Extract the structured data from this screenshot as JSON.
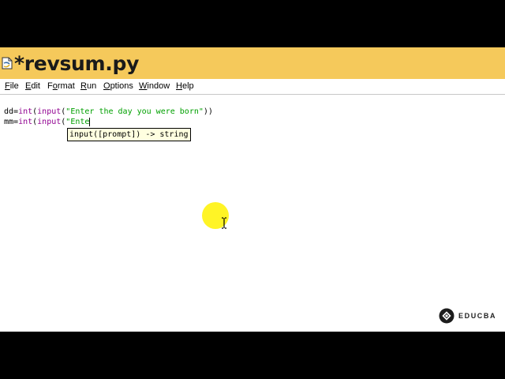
{
  "window": {
    "title": "*revsum.py",
    "title_bar_color": "#f5c95b"
  },
  "menu": {
    "items": [
      {
        "label": "File",
        "underline": "F",
        "rest": "ile"
      },
      {
        "label": "Edit",
        "underline": "E",
        "rest": "dit"
      },
      {
        "label": "Format",
        "prefix": "F",
        "underline": "o",
        "rest": "rmat"
      },
      {
        "label": "Run",
        "underline": "R",
        "rest": "un"
      },
      {
        "label": "Options",
        "underline": "O",
        "rest": "ptions"
      },
      {
        "label": "Window",
        "underline": "W",
        "rest": "indow"
      },
      {
        "label": "Help",
        "underline": "H",
        "rest": "elp"
      }
    ]
  },
  "editor": {
    "lines": [
      {
        "tokens": [
          {
            "text": "dd=",
            "type": "plain"
          },
          {
            "text": "int",
            "type": "builtin"
          },
          {
            "text": "(",
            "type": "plain"
          },
          {
            "text": "input",
            "type": "builtin"
          },
          {
            "text": "(",
            "type": "plain"
          },
          {
            "text": "\"Enter the day you were born\"",
            "type": "string"
          },
          {
            "text": "))",
            "type": "plain"
          }
        ]
      },
      {
        "tokens": [
          {
            "text": "mm=",
            "type": "plain"
          },
          {
            "text": "int",
            "type": "builtin"
          },
          {
            "text": "(",
            "type": "plain"
          },
          {
            "text": "input",
            "type": "builtin"
          },
          {
            "text": "(",
            "type": "plain"
          },
          {
            "text": "\"Ente",
            "type": "string"
          }
        ]
      }
    ],
    "calltip": "input([prompt]) -> string",
    "colors": {
      "builtin": "#900090",
      "string": "#00a000"
    }
  },
  "overlay": {
    "cursor_highlight_color": "#fff200",
    "logo_text": "EDUCBA",
    "logo_icon": "educba-logo-icon"
  }
}
